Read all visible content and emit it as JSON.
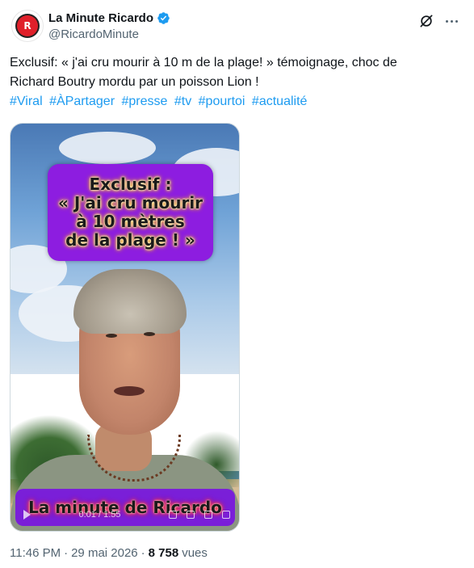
{
  "author": {
    "display_name": "La Minute Ricardo",
    "handle": "@RicardoMinute",
    "avatar_text": "R",
    "verified": true
  },
  "tweet": {
    "text_line1": "Exclusif: « j'ai cru mourir à 10 m de la plage! » témoignage, choc de",
    "text_line2": "Richard Boutry mordu par un poisson Lion !",
    "hashtags": [
      "#Viral",
      "#ÀPartager",
      "#presse",
      "#tv",
      "#pourtoi",
      "#actualité"
    ]
  },
  "video": {
    "card_lines": [
      "Exclusif :",
      "« J'ai cru mourir",
      "à 10 mètres",
      "de la plage ! »"
    ],
    "banner": "La minute de Ricardo",
    "time": "0:01 / 1:55"
  },
  "meta": {
    "time": "11:46 PM",
    "separator": "·",
    "date": "29 mai 2026",
    "separator2": "·",
    "views_count": "8 758",
    "views_label": "vues"
  },
  "colors": {
    "link": "#1d9bf0",
    "verified": "#1d9bf0",
    "card_bg": "#8d1de0",
    "banner_bg": "#7a1fd8",
    "muted": "#536471"
  }
}
